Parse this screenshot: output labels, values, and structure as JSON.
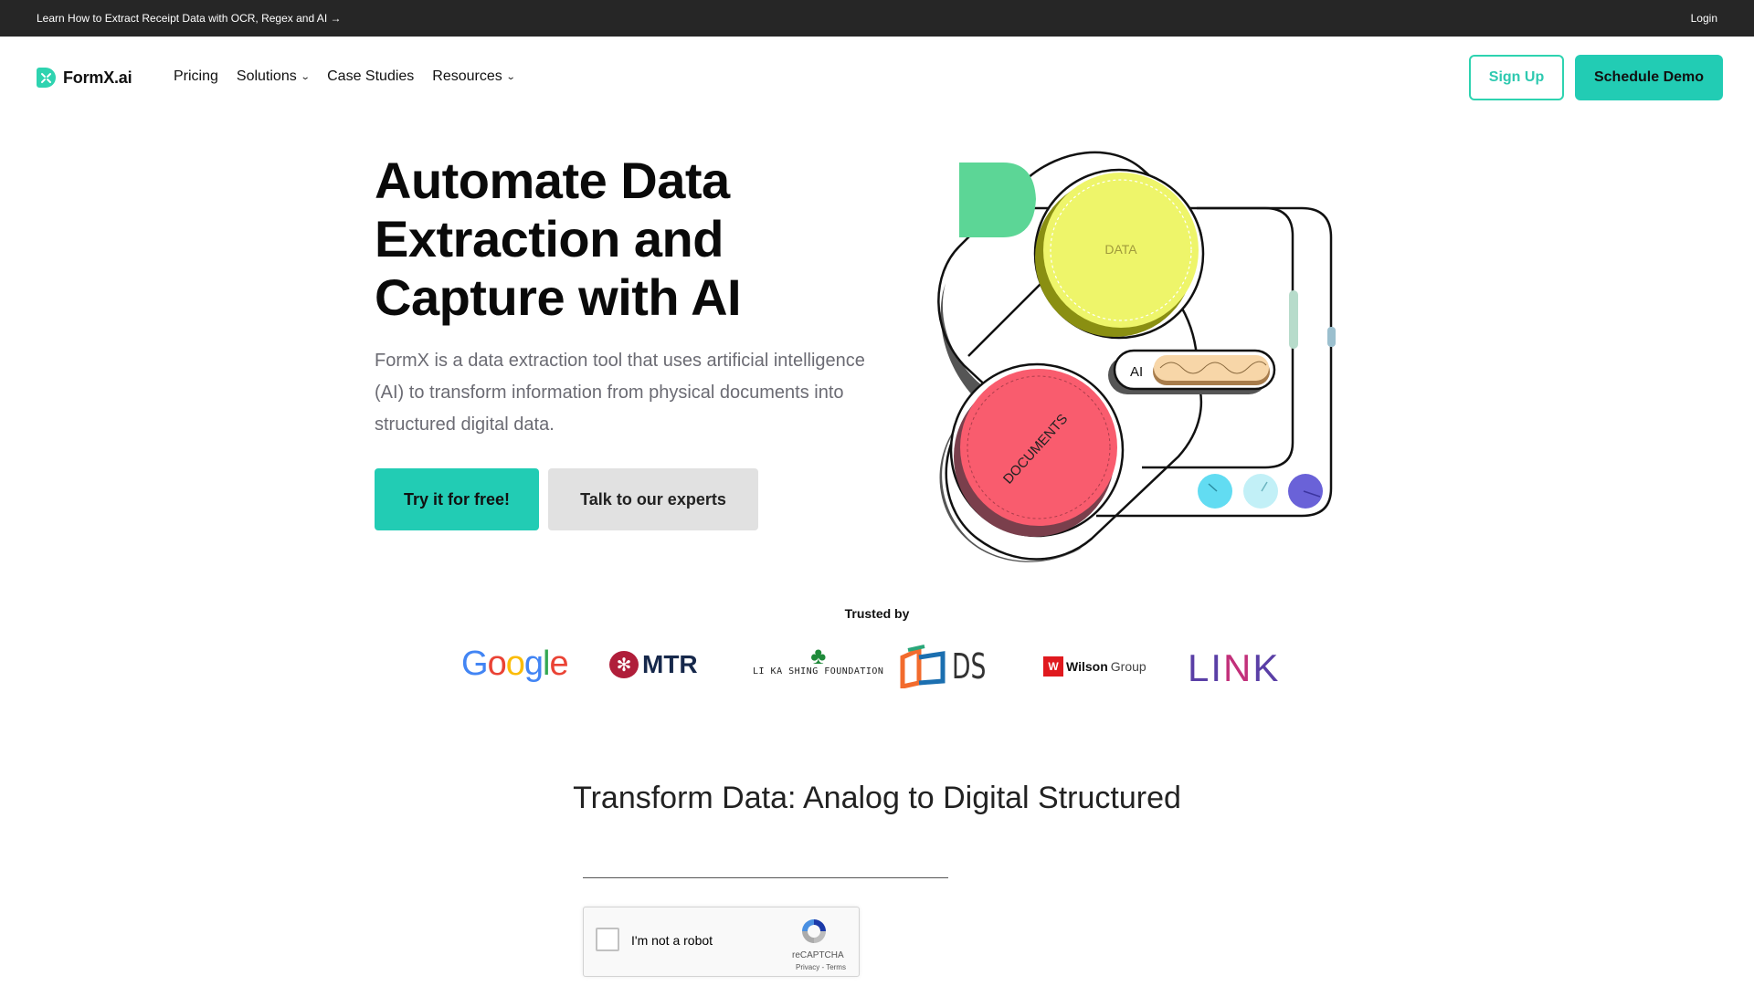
{
  "topbar": {
    "announcement": "Learn How to Extract Receipt Data with OCR, Regex and AI →",
    "login": "Login"
  },
  "nav": {
    "brand": "FormX.ai",
    "links": [
      {
        "label": "Pricing",
        "dropdown": false
      },
      {
        "label": "Solutions",
        "dropdown": true
      },
      {
        "label": "Case Studies",
        "dropdown": false
      },
      {
        "label": "Resources",
        "dropdown": true
      }
    ],
    "signup": "Sign Up",
    "schedule_demo": "Schedule Demo",
    "chevron_icon": "chevron-down-icon"
  },
  "hero": {
    "title": "Automate Data Extraction and Capture with AI",
    "description": "FormX is a data extraction tool that uses artificial intelligence (AI) to transform information from physical documents into structured digital data.",
    "primary_cta": "Try it for free!",
    "secondary_cta": "Talk to our experts",
    "illustration": {
      "data_label": "DATA",
      "documents_label": "DOCUMENTS",
      "ai_label": "AI"
    }
  },
  "trusted": {
    "heading": "Trusted by",
    "logos": [
      "Google",
      "MTR",
      "LI KA SHING FOUNDATION",
      "DS",
      "Wilson Group",
      "LINK"
    ]
  },
  "section": {
    "title": "Transform Data: Analog to Digital Structured"
  },
  "captcha": {
    "label": "I'm not a robot",
    "brand": "reCAPTCHA",
    "links": "Privacy - Terms"
  },
  "colors": {
    "accent": "#22ccb4",
    "topbar": "#262626",
    "data_circle": "#eef56a",
    "documents_circle": "#f95c6e"
  }
}
